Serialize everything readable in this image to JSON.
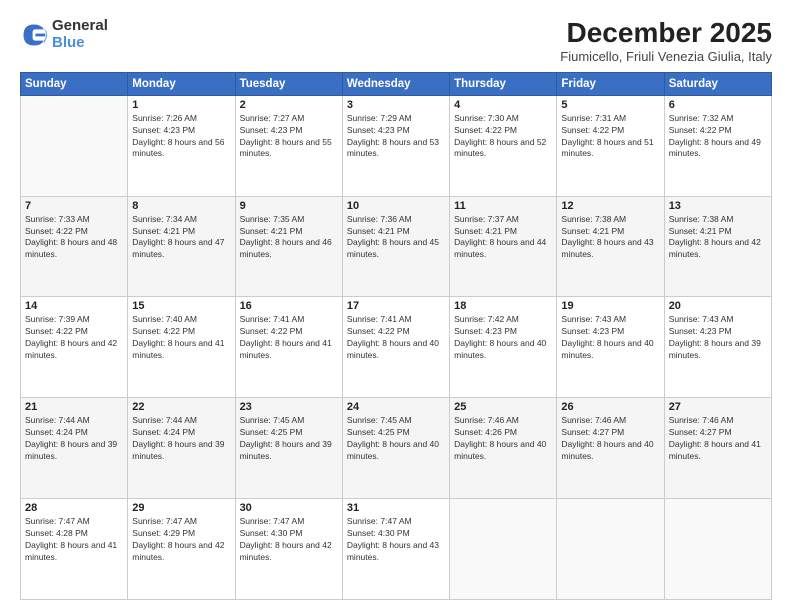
{
  "logo": {
    "line1": "General",
    "line2": "Blue"
  },
  "title": "December 2025",
  "subtitle": "Fiumicello, Friuli Venezia Giulia, Italy",
  "weekdays": [
    "Sunday",
    "Monday",
    "Tuesday",
    "Wednesday",
    "Thursday",
    "Friday",
    "Saturday"
  ],
  "weeks": [
    [
      {
        "day": "",
        "info": ""
      },
      {
        "day": "1",
        "sunrise": "Sunrise: 7:26 AM",
        "sunset": "Sunset: 4:23 PM",
        "daylight": "Daylight: 8 hours and 56 minutes."
      },
      {
        "day": "2",
        "sunrise": "Sunrise: 7:27 AM",
        "sunset": "Sunset: 4:23 PM",
        "daylight": "Daylight: 8 hours and 55 minutes."
      },
      {
        "day": "3",
        "sunrise": "Sunrise: 7:29 AM",
        "sunset": "Sunset: 4:23 PM",
        "daylight": "Daylight: 8 hours and 53 minutes."
      },
      {
        "day": "4",
        "sunrise": "Sunrise: 7:30 AM",
        "sunset": "Sunset: 4:22 PM",
        "daylight": "Daylight: 8 hours and 52 minutes."
      },
      {
        "day": "5",
        "sunrise": "Sunrise: 7:31 AM",
        "sunset": "Sunset: 4:22 PM",
        "daylight": "Daylight: 8 hours and 51 minutes."
      },
      {
        "day": "6",
        "sunrise": "Sunrise: 7:32 AM",
        "sunset": "Sunset: 4:22 PM",
        "daylight": "Daylight: 8 hours and 49 minutes."
      }
    ],
    [
      {
        "day": "7",
        "sunrise": "Sunrise: 7:33 AM",
        "sunset": "Sunset: 4:22 PM",
        "daylight": "Daylight: 8 hours and 48 minutes."
      },
      {
        "day": "8",
        "sunrise": "Sunrise: 7:34 AM",
        "sunset": "Sunset: 4:21 PM",
        "daylight": "Daylight: 8 hours and 47 minutes."
      },
      {
        "day": "9",
        "sunrise": "Sunrise: 7:35 AM",
        "sunset": "Sunset: 4:21 PM",
        "daylight": "Daylight: 8 hours and 46 minutes."
      },
      {
        "day": "10",
        "sunrise": "Sunrise: 7:36 AM",
        "sunset": "Sunset: 4:21 PM",
        "daylight": "Daylight: 8 hours and 45 minutes."
      },
      {
        "day": "11",
        "sunrise": "Sunrise: 7:37 AM",
        "sunset": "Sunset: 4:21 PM",
        "daylight": "Daylight: 8 hours and 44 minutes."
      },
      {
        "day": "12",
        "sunrise": "Sunrise: 7:38 AM",
        "sunset": "Sunset: 4:21 PM",
        "daylight": "Daylight: 8 hours and 43 minutes."
      },
      {
        "day": "13",
        "sunrise": "Sunrise: 7:38 AM",
        "sunset": "Sunset: 4:21 PM",
        "daylight": "Daylight: 8 hours and 42 minutes."
      }
    ],
    [
      {
        "day": "14",
        "sunrise": "Sunrise: 7:39 AM",
        "sunset": "Sunset: 4:22 PM",
        "daylight": "Daylight: 8 hours and 42 minutes."
      },
      {
        "day": "15",
        "sunrise": "Sunrise: 7:40 AM",
        "sunset": "Sunset: 4:22 PM",
        "daylight": "Daylight: 8 hours and 41 minutes."
      },
      {
        "day": "16",
        "sunrise": "Sunrise: 7:41 AM",
        "sunset": "Sunset: 4:22 PM",
        "daylight": "Daylight: 8 hours and 41 minutes."
      },
      {
        "day": "17",
        "sunrise": "Sunrise: 7:41 AM",
        "sunset": "Sunset: 4:22 PM",
        "daylight": "Daylight: 8 hours and 40 minutes."
      },
      {
        "day": "18",
        "sunrise": "Sunrise: 7:42 AM",
        "sunset": "Sunset: 4:23 PM",
        "daylight": "Daylight: 8 hours and 40 minutes."
      },
      {
        "day": "19",
        "sunrise": "Sunrise: 7:43 AM",
        "sunset": "Sunset: 4:23 PM",
        "daylight": "Daylight: 8 hours and 40 minutes."
      },
      {
        "day": "20",
        "sunrise": "Sunrise: 7:43 AM",
        "sunset": "Sunset: 4:23 PM",
        "daylight": "Daylight: 8 hours and 39 minutes."
      }
    ],
    [
      {
        "day": "21",
        "sunrise": "Sunrise: 7:44 AM",
        "sunset": "Sunset: 4:24 PM",
        "daylight": "Daylight: 8 hours and 39 minutes."
      },
      {
        "day": "22",
        "sunrise": "Sunrise: 7:44 AM",
        "sunset": "Sunset: 4:24 PM",
        "daylight": "Daylight: 8 hours and 39 minutes."
      },
      {
        "day": "23",
        "sunrise": "Sunrise: 7:45 AM",
        "sunset": "Sunset: 4:25 PM",
        "daylight": "Daylight: 8 hours and 39 minutes."
      },
      {
        "day": "24",
        "sunrise": "Sunrise: 7:45 AM",
        "sunset": "Sunset: 4:25 PM",
        "daylight": "Daylight: 8 hours and 40 minutes."
      },
      {
        "day": "25",
        "sunrise": "Sunrise: 7:46 AM",
        "sunset": "Sunset: 4:26 PM",
        "daylight": "Daylight: 8 hours and 40 minutes."
      },
      {
        "day": "26",
        "sunrise": "Sunrise: 7:46 AM",
        "sunset": "Sunset: 4:27 PM",
        "daylight": "Daylight: 8 hours and 40 minutes."
      },
      {
        "day": "27",
        "sunrise": "Sunrise: 7:46 AM",
        "sunset": "Sunset: 4:27 PM",
        "daylight": "Daylight: 8 hours and 41 minutes."
      }
    ],
    [
      {
        "day": "28",
        "sunrise": "Sunrise: 7:47 AM",
        "sunset": "Sunset: 4:28 PM",
        "daylight": "Daylight: 8 hours and 41 minutes."
      },
      {
        "day": "29",
        "sunrise": "Sunrise: 7:47 AM",
        "sunset": "Sunset: 4:29 PM",
        "daylight": "Daylight: 8 hours and 42 minutes."
      },
      {
        "day": "30",
        "sunrise": "Sunrise: 7:47 AM",
        "sunset": "Sunset: 4:30 PM",
        "daylight": "Daylight: 8 hours and 42 minutes."
      },
      {
        "day": "31",
        "sunrise": "Sunrise: 7:47 AM",
        "sunset": "Sunset: 4:30 PM",
        "daylight": "Daylight: 8 hours and 43 minutes."
      },
      {
        "day": "",
        "info": ""
      },
      {
        "day": "",
        "info": ""
      },
      {
        "day": "",
        "info": ""
      }
    ]
  ]
}
